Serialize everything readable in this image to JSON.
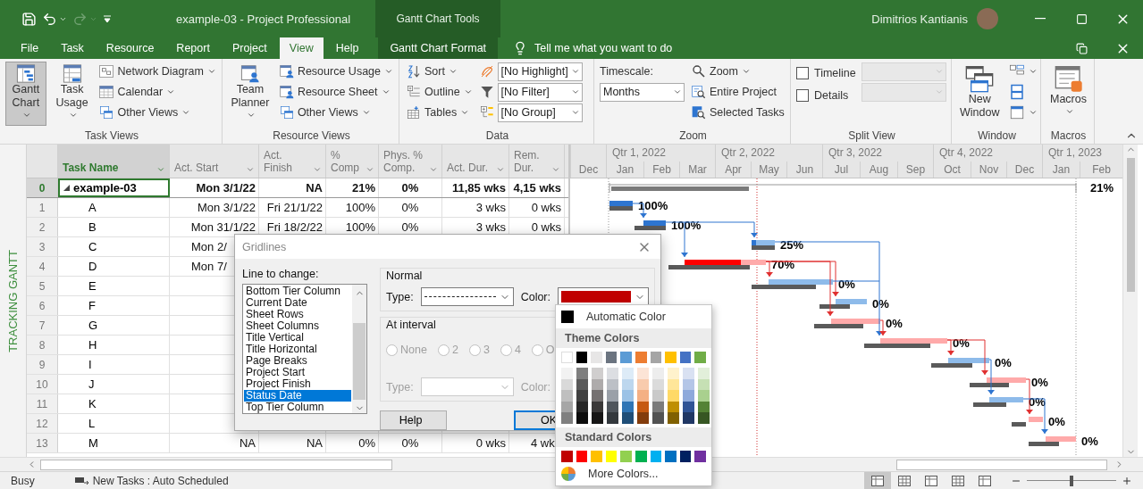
{
  "title_bar": {
    "title": "example-03  -  Project Professional",
    "context_title": "Gantt Chart Tools",
    "user": "Dimitrios Kantianis"
  },
  "tabs": [
    {
      "label": "File",
      "selected": false,
      "kind": "plain"
    },
    {
      "label": "Task",
      "selected": false,
      "kind": "plain"
    },
    {
      "label": "Resource",
      "selected": false,
      "kind": "plain"
    },
    {
      "label": "Report",
      "selected": false,
      "kind": "plain"
    },
    {
      "label": "Project",
      "selected": false,
      "kind": "plain"
    },
    {
      "label": "View",
      "selected": true,
      "kind": "plain"
    },
    {
      "label": "Help",
      "selected": false,
      "kind": "plain"
    },
    {
      "label": "Gantt Chart Format",
      "selected": false,
      "kind": "context"
    }
  ],
  "tell_me": {
    "placeholder": "Tell me what you want to do"
  },
  "ribbon": [
    {
      "title": "Task Views",
      "columns": [
        [
          {
            "kind": "large",
            "label": "Gantt Chart",
            "dropdown": true,
            "pressed": true
          }
        ],
        [
          {
            "kind": "large",
            "label": "Task Usage",
            "dropdown": true,
            "pressed": false
          }
        ],
        [
          {
            "kind": "small",
            "label": "Network Diagram",
            "dropdown": true
          },
          {
            "kind": "small",
            "label": "Calendar",
            "dropdown": true
          },
          {
            "kind": "small",
            "label": "Other Views",
            "dropdown": true
          }
        ]
      ]
    },
    {
      "title": "Resource Views",
      "columns": [
        [
          {
            "kind": "large",
            "label": "Team Planner",
            "dropdown": true,
            "pressed": false
          }
        ],
        [
          {
            "kind": "small",
            "label": "Resource Usage",
            "dropdown": true
          },
          {
            "kind": "small",
            "label": "Resource Sheet",
            "dropdown": true
          },
          {
            "kind": "small",
            "label": "Other Views",
            "dropdown": true
          }
        ]
      ]
    },
    {
      "title": "Data",
      "columns": [
        [
          {
            "kind": "small",
            "label": "Sort",
            "dropdown": true
          },
          {
            "kind": "small",
            "label": "Outline",
            "dropdown": true
          },
          {
            "kind": "small",
            "label": "Tables",
            "dropdown": true
          }
        ],
        [
          {
            "kind": "combo",
            "value": "[No Highlight]",
            "disabled": false
          },
          {
            "kind": "combo",
            "value": "[No Filter]",
            "disabled": false
          },
          {
            "kind": "combo",
            "value": "[No Group]",
            "disabled": false
          }
        ]
      ]
    },
    {
      "title": "Zoom",
      "columns": [
        [
          {
            "kind": "label",
            "label": "Timescale:"
          },
          {
            "kind": "combo",
            "value": "Months",
            "disabled": false
          }
        ],
        [
          {
            "kind": "small",
            "label": "Zoom",
            "dropdown": true
          },
          {
            "kind": "small",
            "label": "Entire Project",
            "dropdown": false
          },
          {
            "kind": "small",
            "label": "Selected Tasks",
            "dropdown": false
          }
        ]
      ]
    },
    {
      "title": "Split View",
      "columns": [
        [
          {
            "kind": "check",
            "label": "Timeline",
            "checked": false
          },
          {
            "kind": "check",
            "label": "Details",
            "checked": false
          }
        ],
        [
          {
            "kind": "combo",
            "disabled": true
          },
          {
            "kind": "combo",
            "disabled": true
          }
        ]
      ]
    },
    {
      "title": "Window",
      "columns": [
        [
          {
            "kind": "large",
            "label": "New Window",
            "dropdown": false,
            "pressed": false
          }
        ],
        [
          {
            "kind": "icon",
            "dropdown": true
          },
          {
            "kind": "icon",
            "dropdown": false
          },
          {
            "kind": "icon",
            "dropdown": true
          }
        ]
      ]
    },
    {
      "title": "Macros",
      "columns": [
        [
          {
            "kind": "large",
            "label": "Macros",
            "dropdown": true,
            "pressed": false
          }
        ]
      ]
    }
  ],
  "view_label": "TRACKING GANTT",
  "columns": [
    {
      "label": "Task Name",
      "selected": true
    },
    {
      "label": "Act. Start",
      "selected": false
    },
    {
      "label": "Act. Finish",
      "selected": false
    },
    {
      "label": "% Comp",
      "selected": false
    },
    {
      "label": "Phys. % Comp.",
      "selected": false
    },
    {
      "label": "Act. Dur.",
      "selected": false
    },
    {
      "label": "Rem. Dur.",
      "selected": false
    }
  ],
  "rows": [
    {
      "id": "0",
      "name": "example-03",
      "summary": true,
      "expanded": true,
      "selected": true,
      "act_start": "Mon 3/1/22",
      "act_finish": "NA",
      "pct_comp": "21%",
      "phys_comp": "0%",
      "act_dur": "11,85 wks",
      "rem_dur": "4,15 wks",
      "gantt": {
        "label": "21%"
      }
    },
    {
      "id": "1",
      "name": "A",
      "summary": false,
      "selected": false,
      "act_start": "Mon 3/1/22",
      "act_finish": "Fri 21/1/22",
      "pct_comp": "100%",
      "phys_comp": "0%",
      "act_dur": "3 wks",
      "rem_dur": "0 wks",
      "gantt": {
        "label": "100%",
        "critical": false
      }
    },
    {
      "id": "2",
      "name": "B",
      "summary": false,
      "selected": false,
      "act_start": "Mon 31/1/22",
      "act_finish": "Fri 18/2/22",
      "pct_comp": "100%",
      "phys_comp": "0%",
      "act_dur": "3 wks",
      "rem_dur": "0 wks",
      "gantt": {
        "label": "100%",
        "critical": false
      }
    },
    {
      "id": "3",
      "name": "C",
      "summary": false,
      "selected": false,
      "act_start": {
        "text": "Mon 2/",
        "covered": true
      },
      "gantt": {
        "label": "25%",
        "critical": false
      }
    },
    {
      "id": "4",
      "name": "D",
      "summary": false,
      "selected": false,
      "act_start": {
        "text": "Mon 7/",
        "covered": true
      },
      "gantt": {
        "label": "70%",
        "critical": true
      }
    },
    {
      "id": "5",
      "name": "E",
      "summary": false,
      "selected": false,
      "gantt": {
        "label": "0%",
        "critical": false
      }
    },
    {
      "id": "6",
      "name": "F",
      "summary": false,
      "selected": false,
      "gantt": {
        "label": "0%",
        "critical": false
      }
    },
    {
      "id": "7",
      "name": "G",
      "summary": false,
      "selected": false,
      "gantt": {
        "label": "0%",
        "critical": true
      }
    },
    {
      "id": "8",
      "name": "H",
      "summary": false,
      "selected": false,
      "gantt": {
        "label": "0%",
        "critical": true
      }
    },
    {
      "id": "9",
      "name": "I",
      "summary": false,
      "selected": false,
      "gantt": {
        "label": "0%",
        "critical": false
      }
    },
    {
      "id": "10",
      "name": "J",
      "summary": false,
      "selected": false,
      "gantt": {
        "label": "0%",
        "critical": true
      }
    },
    {
      "id": "11",
      "name": "K",
      "summary": false,
      "selected": false,
      "gantt": {
        "label": "0%",
        "critical": false
      }
    },
    {
      "id": "12",
      "name": "L",
      "summary": false,
      "selected": false,
      "gantt": {
        "label": "0%",
        "critical": true
      }
    },
    {
      "id": "13",
      "name": "M",
      "summary": false,
      "selected": false,
      "act_start": "NA",
      "act_finish": "NA",
      "pct_comp": "0%",
      "phys_comp": "0%",
      "act_dur": "0 wks",
      "rem_dur": {
        "text": "4 wk",
        "covered": true
      },
      "gantt": {
        "label": "0%",
        "critical": true
      }
    }
  ],
  "timescale": {
    "quarters": [
      "Qtr 1, 2022",
      "Qtr 2, 2022",
      "Qtr 3, 2022",
      "Qtr 4, 2022",
      "Qtr 1, 2023"
    ],
    "months": [
      "Dec",
      "Jan",
      "Feb",
      "Mar",
      "Apr",
      "May",
      "Jun",
      "Jul",
      "Aug",
      "Sep",
      "Oct",
      "Nov",
      "Dec",
      "Jan",
      "Feb"
    ]
  },
  "dialog": {
    "title": "Gridlines",
    "line_label": "Line to change:",
    "lines": [
      {
        "label": "Bottom Tier Column",
        "selected": false
      },
      {
        "label": "Current Date",
        "selected": false
      },
      {
        "label": "Sheet Rows",
        "selected": false
      },
      {
        "label": "Sheet Columns",
        "selected": false
      },
      {
        "label": "Title Vertical",
        "selected": false
      },
      {
        "label": "Title Horizontal",
        "selected": false
      },
      {
        "label": "Page Breaks",
        "selected": false
      },
      {
        "label": "Project Start",
        "selected": false
      },
      {
        "label": "Project Finish",
        "selected": false
      },
      {
        "label": "Status Date",
        "selected": true
      },
      {
        "label": "Top Tier Column",
        "selected": false
      }
    ],
    "normal": {
      "title": "Normal",
      "type_label": "Type:",
      "dashed": true,
      "color_label": "Color:",
      "color": "#c00000"
    },
    "interval": {
      "title": "At interval",
      "disabled": true,
      "options": [
        {
          "label": "None",
          "selected": false
        },
        {
          "label": "2",
          "selected": false
        },
        {
          "label": "3",
          "selected": false
        },
        {
          "label": "4",
          "selected": false
        },
        {
          "label": "O",
          "selected": false
        }
      ],
      "type_label": "Type:",
      "color_label": "Color:"
    },
    "buttons": [
      {
        "label": "Help",
        "default": false
      },
      {
        "label": "OK",
        "default": true
      }
    ]
  },
  "color_menu": {
    "automatic": {
      "label": "Automatic Color",
      "color": "#000000"
    },
    "theme_title": "Theme Colors",
    "theme": [
      {
        "color": "#ffffff",
        "shades": [
          {
            "color": "#f2f2f2"
          },
          {
            "color": "#d9d9d9"
          },
          {
            "color": "#bfbfbf"
          },
          {
            "color": "#a6a6a6"
          },
          {
            "color": "#808080"
          }
        ]
      },
      {
        "color": "#000000",
        "shades": [
          {
            "color": "#7f7f7f"
          },
          {
            "color": "#595959"
          },
          {
            "color": "#404040"
          },
          {
            "color": "#262626"
          },
          {
            "color": "#0d0d0d"
          }
        ]
      },
      {
        "color": "#e7e6e6",
        "shades": [
          {
            "color": "#d0cece"
          },
          {
            "color": "#aeabab"
          },
          {
            "color": "#757171"
          },
          {
            "color": "#3a3838"
          },
          {
            "color": "#171616"
          }
        ]
      },
      {
        "color": "#6b7480",
        "shades": [
          {
            "color": "#dcdee2"
          },
          {
            "color": "#bcc0c6"
          },
          {
            "color": "#9aa0a8"
          },
          {
            "color": "#4f555c"
          },
          {
            "color": "#33383d"
          }
        ]
      },
      {
        "color": "#5b9bd5",
        "shades": [
          {
            "color": "#ddebf7"
          },
          {
            "color": "#bdd7ee"
          },
          {
            "color": "#9bc2e6"
          },
          {
            "color": "#2f75b5"
          },
          {
            "color": "#1f4e78"
          }
        ]
      },
      {
        "color": "#ed7d31",
        "shades": [
          {
            "color": "#fce4d6"
          },
          {
            "color": "#f8cbad"
          },
          {
            "color": "#f4b084"
          },
          {
            "color": "#c65911"
          },
          {
            "color": "#833c0c"
          }
        ]
      },
      {
        "color": "#a5a5a5",
        "shades": [
          {
            "color": "#ededed"
          },
          {
            "color": "#dbdbdb"
          },
          {
            "color": "#c9c9c9"
          },
          {
            "color": "#7b7b7b"
          },
          {
            "color": "#525252"
          }
        ]
      },
      {
        "color": "#ffc000",
        "shades": [
          {
            "color": "#fff2cc"
          },
          {
            "color": "#ffe699"
          },
          {
            "color": "#ffd966"
          },
          {
            "color": "#bf8f00"
          },
          {
            "color": "#806000"
          }
        ]
      },
      {
        "color": "#4472c4",
        "shades": [
          {
            "color": "#d9e1f2"
          },
          {
            "color": "#b4c6e7"
          },
          {
            "color": "#8ea9db"
          },
          {
            "color": "#305496"
          },
          {
            "color": "#203764"
          }
        ]
      },
      {
        "color": "#70ad47",
        "shades": [
          {
            "color": "#e2efda"
          },
          {
            "color": "#c6e0b4"
          },
          {
            "color": "#a9d08e"
          },
          {
            "color": "#548235"
          },
          {
            "color": "#375623"
          }
        ]
      }
    ],
    "standard_title": "Standard Colors",
    "standard": [
      {
        "color": "#c00000"
      },
      {
        "color": "#ff0000"
      },
      {
        "color": "#ffc000"
      },
      {
        "color": "#ffff00"
      },
      {
        "color": "#92d050"
      },
      {
        "color": "#00b050"
      },
      {
        "color": "#00b0f0"
      },
      {
        "color": "#0070c0"
      },
      {
        "color": "#002060"
      },
      {
        "color": "#7030a0"
      }
    ],
    "more": "More Colors..."
  },
  "status_bar": {
    "state": "Busy",
    "mode": "New Tasks : Auto Scheduled",
    "views": [
      {
        "selected": true
      },
      {
        "selected": false
      },
      {
        "selected": false
      },
      {
        "selected": false
      },
      {
        "selected": false
      }
    ],
    "zoom": {
      "level": 0.5
    }
  }
}
